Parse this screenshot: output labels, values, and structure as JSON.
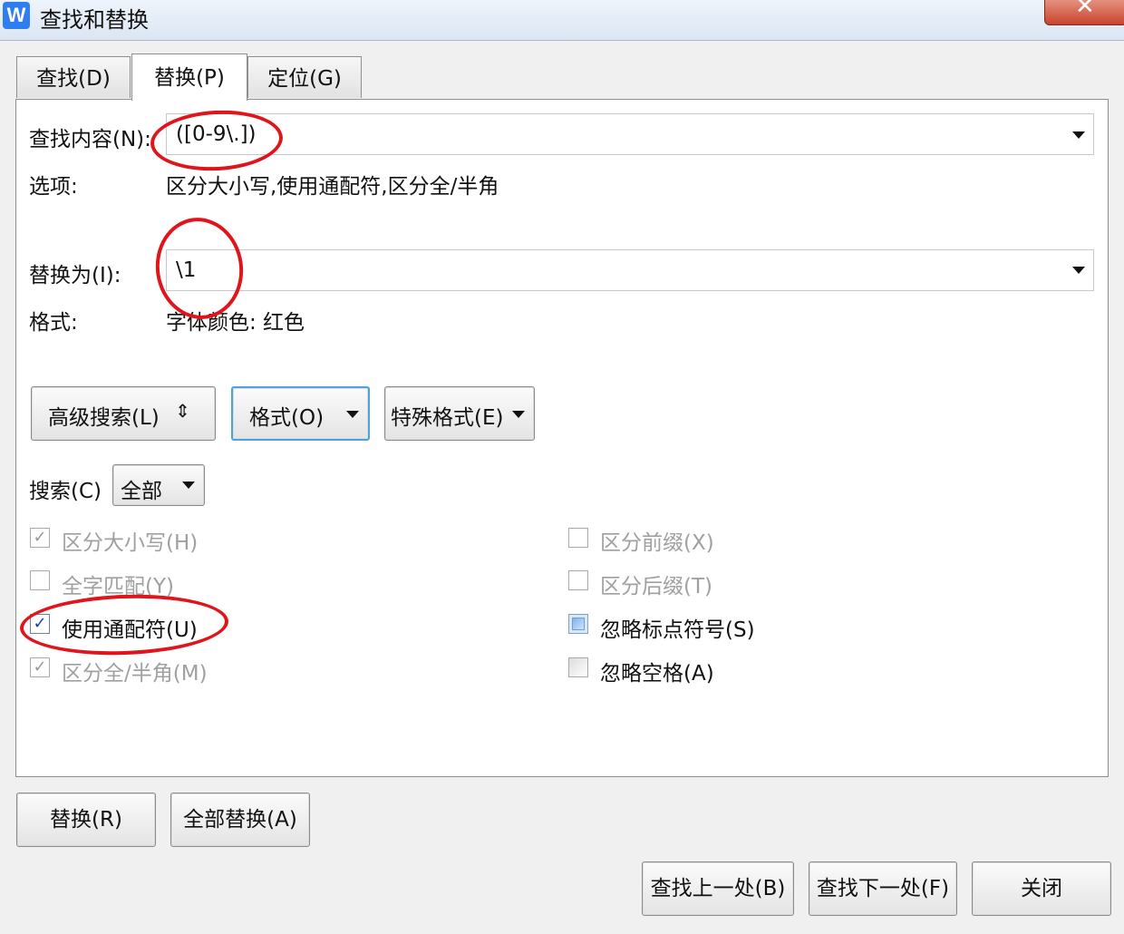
{
  "window": {
    "title": "查找和替换",
    "app_icon": "W"
  },
  "tabs": [
    {
      "label": "查找(D)"
    },
    {
      "label": "替换(P)"
    },
    {
      "label": "定位(G)"
    }
  ],
  "find": {
    "label": "查找内容(N):",
    "value": "([0-9\\.])"
  },
  "options": {
    "label": "选项:",
    "value": "区分大小写,使用通配符,区分全/半角"
  },
  "replace": {
    "label": "替换为(I):",
    "value": "\\1"
  },
  "format": {
    "label": "格式:",
    "value": "字体颜色: 红色"
  },
  "buttons": {
    "advanced": "高级搜索(L)",
    "advanced_glyph": "⇕",
    "format": "格式(O)",
    "special": "特殊格式(E)",
    "replace": "替换(R)",
    "replace_all": "全部替换(A)",
    "find_prev": "查找上一处(B)",
    "find_next": "查找下一处(F)",
    "close": "关闭"
  },
  "search": {
    "label": "搜索(C)",
    "value": "全部"
  },
  "checkboxes": {
    "match_case": {
      "label": "区分大小写(H)",
      "checked": true,
      "disabled": true
    },
    "whole_word": {
      "label": "全字匹配(Y)",
      "checked": false,
      "disabled": true
    },
    "wildcards": {
      "label": "使用通配符(U)",
      "checked": true,
      "disabled": false
    },
    "full_half": {
      "label": "区分全/半角(M)",
      "checked": true,
      "disabled": true
    },
    "prefix": {
      "label": "区分前缀(X)",
      "checked": false,
      "disabled": true
    },
    "suffix": {
      "label": "区分后缀(T)",
      "checked": false,
      "disabled": true
    },
    "ignore_punct": {
      "label": "忽略标点符号(S)",
      "checked": false,
      "disabled": false
    },
    "ignore_space": {
      "label": "忽略空格(A)",
      "checked": false,
      "disabled": false
    }
  },
  "glyphs": {
    "check": "✓",
    "close": "✕"
  },
  "colors": {
    "annotation": "#e0141b",
    "app_icon": "#2f7ef0"
  }
}
